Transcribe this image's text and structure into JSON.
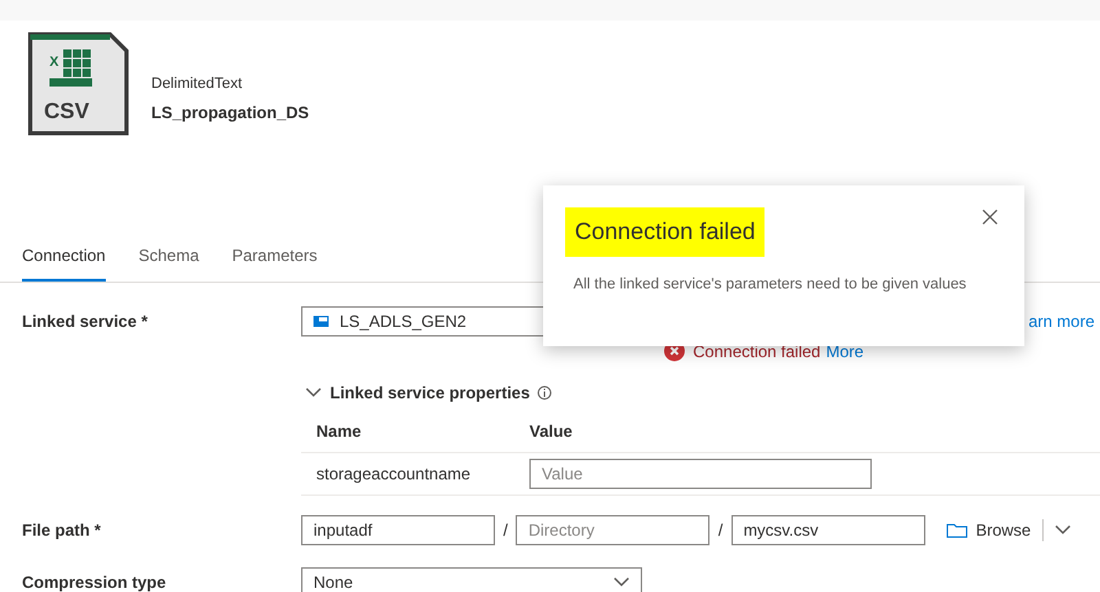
{
  "header": {
    "icon_letter": "X",
    "icon_label": "CSV",
    "type": "DelimitedText",
    "name": "LS_propagation_DS"
  },
  "tabs": [
    {
      "label": "Connection",
      "selected": true
    },
    {
      "label": "Schema",
      "selected": false
    },
    {
      "label": "Parameters",
      "selected": false
    }
  ],
  "linked_service": {
    "label": "Linked service *",
    "value": "LS_ADLS_GEN2",
    "link": "arn more",
    "status": "Connection failed",
    "status_link": "More"
  },
  "properties": {
    "title": "Linked service properties",
    "expanded": true,
    "columns": [
      "Name",
      "Value"
    ],
    "rows": [
      {
        "name": "storageaccountname",
        "placeholder": "Value"
      }
    ]
  },
  "file_path": {
    "label": "File path *",
    "container": "inputadf",
    "directory_placeholder": "Directory",
    "file": "mycsv.csv",
    "separator": "/",
    "browse": "Browse"
  },
  "compression": {
    "label": "Compression type",
    "value": "None"
  },
  "popup": {
    "title": "Connection failed",
    "message": "All the linked service's parameters need to be given values"
  }
}
